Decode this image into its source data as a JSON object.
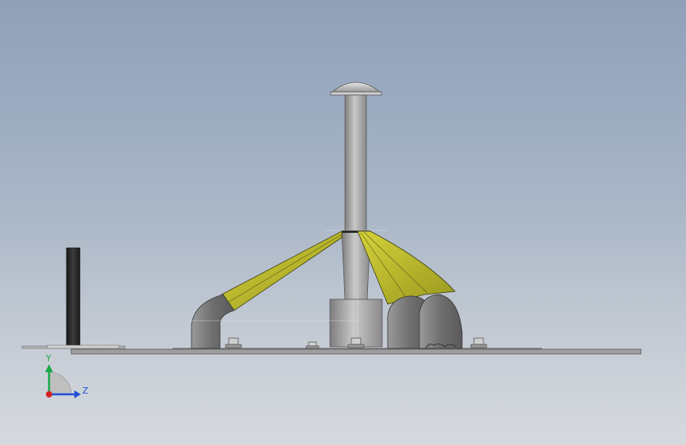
{
  "viewport": {
    "background_top": "#8fa0b8",
    "background_bottom": "#d6dadf"
  },
  "triad": {
    "y_label": "Y",
    "z_label": "Z",
    "y_color": "#1aa84a",
    "z_color": "#1f4fd6",
    "origin_color": "#d62020"
  },
  "model": {
    "accent_yellow": "#b6b42a",
    "metal_gray": "#8c8c8c",
    "dark_gray": "#5c5c5c",
    "post_black": "#2a2a2a"
  }
}
